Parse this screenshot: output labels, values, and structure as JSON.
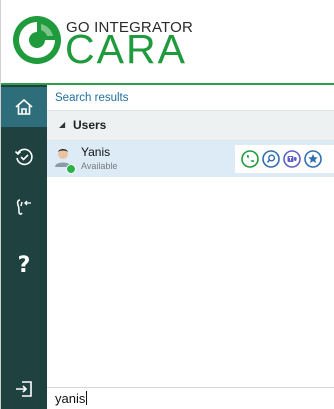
{
  "brand": {
    "top_text": "GO INTEGRATOR",
    "main_text": "CARA",
    "accent_color": "#1f9a3c"
  },
  "sidebar": {
    "items": [
      {
        "icon": "home-icon",
        "active": true
      },
      {
        "icon": "history-icon",
        "active": false
      },
      {
        "icon": "voicemail-transfer-icon",
        "active": false
      },
      {
        "icon": "help-icon",
        "label": "?",
        "active": false
      },
      {
        "icon": "logout-icon",
        "active": false
      }
    ],
    "color": "#1f4240",
    "active_color": "#2e6e7a"
  },
  "results": {
    "title": "Search results",
    "groups": [
      {
        "label": "Users",
        "expanded": true,
        "items": [
          {
            "name": "Yanis",
            "status": "Available",
            "status_color": "#2fb14a",
            "actions": [
              "call-icon",
              "search-icon",
              "teams-icon",
              "favorite-icon"
            ]
          }
        ]
      }
    ]
  },
  "search": {
    "value": "yanis"
  }
}
